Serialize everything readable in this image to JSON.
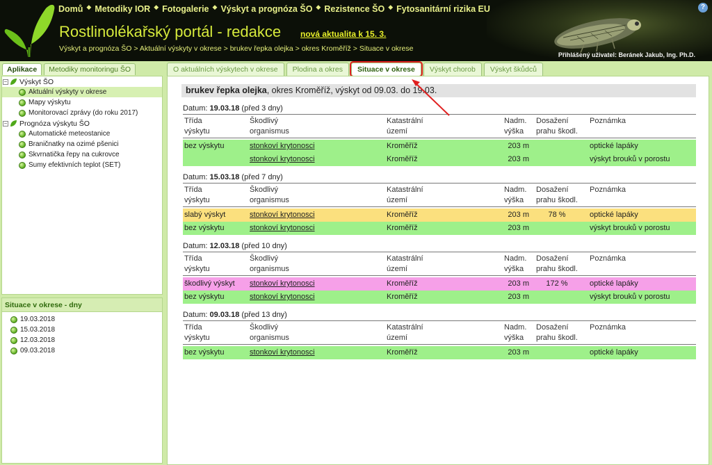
{
  "header": {
    "nav": [
      "Domů",
      "Metodiky IOR",
      "Fotogalerie",
      "Výskyt a prognóza ŠO",
      "Rezistence ŠO",
      "Fytosanitární rizika EU"
    ],
    "title": "Rostlinolékařský portál - redakce",
    "news_link": "nová aktualita k 15. 3.",
    "breadcrumb": "Výskyt a prognóza ŠO > Aktuální výskyty v okrese > brukev řepka olejka > okres Kroměříž > Situace v okrese",
    "user_info": "Přihlášený uživatel: Beránek Jakub, Ing. Ph.D.",
    "help": "?"
  },
  "left_tabs": [
    "Aplikace",
    "Metodiky monitoringu ŠO"
  ],
  "tree": {
    "group1": "Výskyt ŠO",
    "group1_items": [
      "Aktuální výskyty v okrese",
      "Mapy výskytu",
      "Monitorovací zprávy (do roku 2017)"
    ],
    "group2": "Prognóza výskytu ŠO",
    "group2_items": [
      "Automatické meteostanice",
      "Braničnatky na ozimé pšenici",
      "Skvrnatička řepy na cukrovce",
      "Sumy efektivních teplot (SET)"
    ]
  },
  "days_panel": {
    "title": "Situace v okrese - dny",
    "days": [
      "19.03.2018",
      "15.03.2018",
      "12.03.2018",
      "09.03.2018"
    ]
  },
  "main_tabs": [
    "O aktuálních výskytech v okrese",
    "Plodina a okres",
    "Situace v okrese",
    "Výskyt chorob",
    "Výskyt škůdců"
  ],
  "heading": {
    "crop": "brukev řepka olejka",
    "rest": ", okres Kroměříž, výskyt od 09.03. do 19.03."
  },
  "columns": {
    "c1a": "Třída",
    "c1b": "výskytu",
    "c2a": "Škodlivý",
    "c2b": "organismus",
    "c3a": "Katastrální",
    "c3b": "území",
    "c4a": "Nadm.",
    "c4b": "výška",
    "c5a": "Dosažení",
    "c5b": "prahu škodl.",
    "c6a": "Poznámka"
  },
  "date_label": "Datum:",
  "sections": [
    {
      "date": "19.03.18",
      "ago": "(před 3 dny)",
      "rows": [
        {
          "class": "bez výskytu",
          "organism": "stonkoví krytonosci",
          "area": "Kroměříž",
          "alt": "203 m",
          "threshold": "",
          "note": "optické lapáky",
          "color": "#9ef08a"
        },
        {
          "class": "",
          "organism": "stonkoví krytonosci",
          "area": "Kroměříž",
          "alt": "203 m",
          "threshold": "",
          "note": "výskyt brouků v porostu",
          "color": "#9ef08a"
        }
      ]
    },
    {
      "date": "15.03.18",
      "ago": "(před 7 dny)",
      "rows": [
        {
          "class": "slabý výskyt",
          "organism": "stonkoví krytonosci",
          "area": "Kroměříž",
          "alt": "203 m",
          "threshold": "78 %",
          "note": "optické lapáky",
          "color": "#fbe07e"
        },
        {
          "class": "bez výskytu",
          "organism": "stonkoví krytonosci",
          "area": "Kroměříž",
          "alt": "203 m",
          "threshold": "",
          "note": "výskyt brouků v porostu",
          "color": "#9ef08a"
        }
      ]
    },
    {
      "date": "12.03.18",
      "ago": "(před 10 dny)",
      "rows": [
        {
          "class": "škodlivý výskyt",
          "organism": "stonkoví krytonosci",
          "area": "Kroměříž",
          "alt": "203 m",
          "threshold": "172 %",
          "note": "optické lapáky",
          "color": "#f6a0e8"
        },
        {
          "class": "bez výskytu",
          "organism": "stonkoví krytonosci",
          "area": "Kroměříž",
          "alt": "203 m",
          "threshold": "",
          "note": "výskyt brouků v porostu",
          "color": "#9ef08a"
        }
      ]
    },
    {
      "date": "09.03.18",
      "ago": "(před 13 dny)",
      "rows": [
        {
          "class": "bez výskytu",
          "organism": "stonkoví krytonosci",
          "area": "Kroměříž",
          "alt": "203 m",
          "threshold": "",
          "note": "optické lapáky",
          "color": "#9ef08a"
        }
      ]
    }
  ]
}
